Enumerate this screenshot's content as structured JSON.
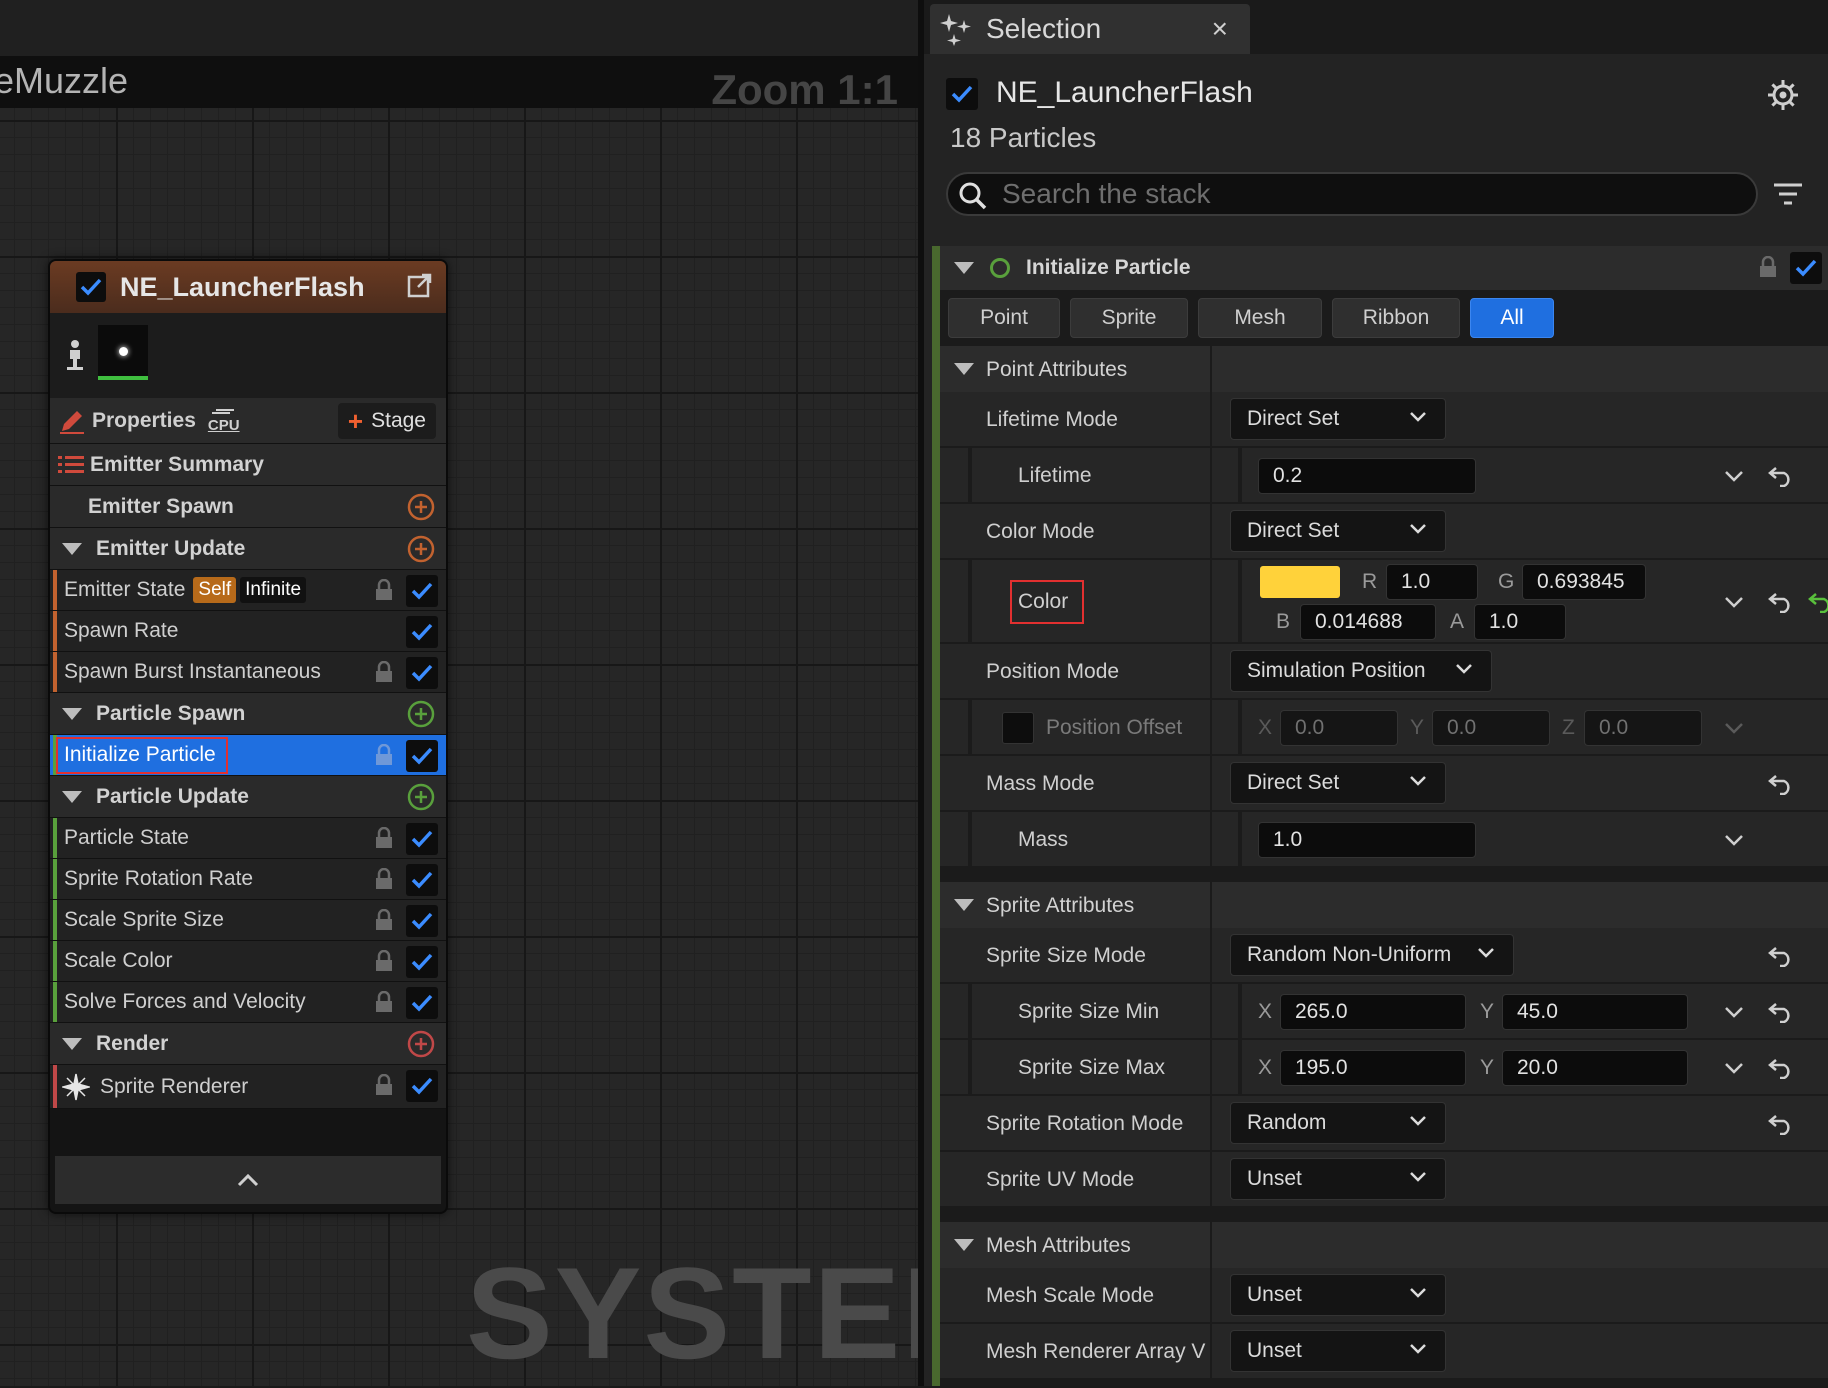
{
  "graph": {
    "title": "eMuzzle",
    "zoom": "Zoom 1:1",
    "watermark": "SYSTEM"
  },
  "node": {
    "title": "NE_LauncherFlash",
    "properties_label": "Properties",
    "cpu_label": "CPU",
    "stage_label": "Stage",
    "emitter_summary": "Emitter Summary",
    "emitter_spawn": "Emitter Spawn",
    "emitter_update": "Emitter Update",
    "emitter_state": "Emitter State",
    "badge_self": "Self",
    "badge_infinite": "Infinite",
    "spawn_rate": "Spawn Rate",
    "spawn_burst": "Spawn Burst Instantaneous",
    "particle_spawn": "Particle Spawn",
    "initialize_particle": "Initialize Particle",
    "particle_update": "Particle Update",
    "particle_state": "Particle State",
    "sprite_rotation_rate": "Sprite Rotation Rate",
    "scale_sprite_size": "Scale Sprite Size",
    "scale_color": "Scale Color",
    "solve_forces": "Solve Forces and Velocity",
    "render": "Render",
    "sprite_renderer": "Sprite Renderer"
  },
  "panel": {
    "tab_title": "Selection",
    "close": "×",
    "selected_name": "NE_LauncherFlash",
    "particle_count": "18 Particles",
    "search_placeholder": "Search the stack",
    "module_title": "Initialize Particle",
    "filters": [
      "Point",
      "Sprite",
      "Mesh",
      "Ribbon",
      "All"
    ],
    "active_filter": "All"
  },
  "point_attributes": {
    "title": "Point Attributes",
    "lifetime_mode_label": "Lifetime Mode",
    "lifetime_mode": "Direct Set",
    "lifetime_label": "Lifetime",
    "lifetime": "0.2",
    "color_mode_label": "Color Mode",
    "color_mode": "Direct Set",
    "color_label": "Color",
    "color_swatch": "#ffd23a",
    "r_label": "R",
    "r": "1.0",
    "g_label": "G",
    "g": "0.693845",
    "b_label": "B",
    "b": "0.014688",
    "a_label": "A",
    "a": "1.0",
    "position_mode_label": "Position Mode",
    "position_mode": "Simulation Position",
    "position_offset_label": "Position Offset",
    "px_label": "X",
    "px": "0.0",
    "py_label": "Y",
    "py": "0.0",
    "pz_label": "Z",
    "pz": "0.0",
    "mass_mode_label": "Mass Mode",
    "mass_mode": "Direct Set",
    "mass_label": "Mass",
    "mass": "1.0"
  },
  "sprite_attributes": {
    "title": "Sprite Attributes",
    "size_mode_label": "Sprite Size Mode",
    "size_mode": "Random Non-Uniform",
    "size_min_label": "Sprite Size Min",
    "min_x_label": "X",
    "min_x": "265.0",
    "min_y_label": "Y",
    "min_y": "45.0",
    "size_max_label": "Sprite Size Max",
    "max_x_label": "X",
    "max_x": "195.0",
    "max_y_label": "Y",
    "max_y": "20.0",
    "rotation_mode_label": "Sprite Rotation Mode",
    "rotation_mode": "Random",
    "uv_mode_label": "Sprite UV Mode",
    "uv_mode": "Unset"
  },
  "mesh_attributes": {
    "title": "Mesh Attributes",
    "scale_mode_label": "Mesh Scale Mode",
    "scale_mode": "Unset",
    "renderer_array_label": "Mesh Renderer Array V",
    "renderer_array": "Unset"
  },
  "colors": {
    "accent_blue": "#1f6fe0",
    "check_blue": "#3b8cff",
    "emitter_orange": "#c2622f",
    "spawn_green": "#59a03c",
    "render_red": "#c04848",
    "highlight_red": "#e23030"
  }
}
